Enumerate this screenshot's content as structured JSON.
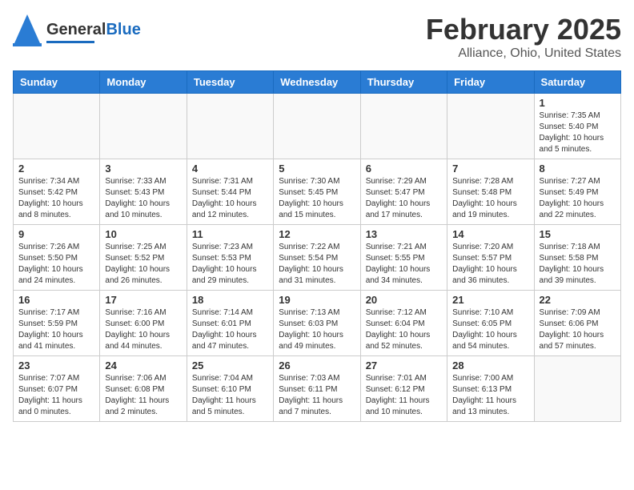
{
  "header": {
    "logo_general": "General",
    "logo_blue": "Blue",
    "title": "February 2025",
    "subtitle": "Alliance, Ohio, United States"
  },
  "days_of_week": [
    "Sunday",
    "Monday",
    "Tuesday",
    "Wednesday",
    "Thursday",
    "Friday",
    "Saturday"
  ],
  "weeks": [
    [
      {
        "day": "",
        "info": ""
      },
      {
        "day": "",
        "info": ""
      },
      {
        "day": "",
        "info": ""
      },
      {
        "day": "",
        "info": ""
      },
      {
        "day": "",
        "info": ""
      },
      {
        "day": "",
        "info": ""
      },
      {
        "day": "1",
        "info": "Sunrise: 7:35 AM\nSunset: 5:40 PM\nDaylight: 10 hours and 5 minutes."
      }
    ],
    [
      {
        "day": "2",
        "info": "Sunrise: 7:34 AM\nSunset: 5:42 PM\nDaylight: 10 hours and 8 minutes."
      },
      {
        "day": "3",
        "info": "Sunrise: 7:33 AM\nSunset: 5:43 PM\nDaylight: 10 hours and 10 minutes."
      },
      {
        "day": "4",
        "info": "Sunrise: 7:31 AM\nSunset: 5:44 PM\nDaylight: 10 hours and 12 minutes."
      },
      {
        "day": "5",
        "info": "Sunrise: 7:30 AM\nSunset: 5:45 PM\nDaylight: 10 hours and 15 minutes."
      },
      {
        "day": "6",
        "info": "Sunrise: 7:29 AM\nSunset: 5:47 PM\nDaylight: 10 hours and 17 minutes."
      },
      {
        "day": "7",
        "info": "Sunrise: 7:28 AM\nSunset: 5:48 PM\nDaylight: 10 hours and 19 minutes."
      },
      {
        "day": "8",
        "info": "Sunrise: 7:27 AM\nSunset: 5:49 PM\nDaylight: 10 hours and 22 minutes."
      }
    ],
    [
      {
        "day": "9",
        "info": "Sunrise: 7:26 AM\nSunset: 5:50 PM\nDaylight: 10 hours and 24 minutes."
      },
      {
        "day": "10",
        "info": "Sunrise: 7:25 AM\nSunset: 5:52 PM\nDaylight: 10 hours and 26 minutes."
      },
      {
        "day": "11",
        "info": "Sunrise: 7:23 AM\nSunset: 5:53 PM\nDaylight: 10 hours and 29 minutes."
      },
      {
        "day": "12",
        "info": "Sunrise: 7:22 AM\nSunset: 5:54 PM\nDaylight: 10 hours and 31 minutes."
      },
      {
        "day": "13",
        "info": "Sunrise: 7:21 AM\nSunset: 5:55 PM\nDaylight: 10 hours and 34 minutes."
      },
      {
        "day": "14",
        "info": "Sunrise: 7:20 AM\nSunset: 5:57 PM\nDaylight: 10 hours and 36 minutes."
      },
      {
        "day": "15",
        "info": "Sunrise: 7:18 AM\nSunset: 5:58 PM\nDaylight: 10 hours and 39 minutes."
      }
    ],
    [
      {
        "day": "16",
        "info": "Sunrise: 7:17 AM\nSunset: 5:59 PM\nDaylight: 10 hours and 41 minutes."
      },
      {
        "day": "17",
        "info": "Sunrise: 7:16 AM\nSunset: 6:00 PM\nDaylight: 10 hours and 44 minutes."
      },
      {
        "day": "18",
        "info": "Sunrise: 7:14 AM\nSunset: 6:01 PM\nDaylight: 10 hours and 47 minutes."
      },
      {
        "day": "19",
        "info": "Sunrise: 7:13 AM\nSunset: 6:03 PM\nDaylight: 10 hours and 49 minutes."
      },
      {
        "day": "20",
        "info": "Sunrise: 7:12 AM\nSunset: 6:04 PM\nDaylight: 10 hours and 52 minutes."
      },
      {
        "day": "21",
        "info": "Sunrise: 7:10 AM\nSunset: 6:05 PM\nDaylight: 10 hours and 54 minutes."
      },
      {
        "day": "22",
        "info": "Sunrise: 7:09 AM\nSunset: 6:06 PM\nDaylight: 10 hours and 57 minutes."
      }
    ],
    [
      {
        "day": "23",
        "info": "Sunrise: 7:07 AM\nSunset: 6:07 PM\nDaylight: 11 hours and 0 minutes."
      },
      {
        "day": "24",
        "info": "Sunrise: 7:06 AM\nSunset: 6:08 PM\nDaylight: 11 hours and 2 minutes."
      },
      {
        "day": "25",
        "info": "Sunrise: 7:04 AM\nSunset: 6:10 PM\nDaylight: 11 hours and 5 minutes."
      },
      {
        "day": "26",
        "info": "Sunrise: 7:03 AM\nSunset: 6:11 PM\nDaylight: 11 hours and 7 minutes."
      },
      {
        "day": "27",
        "info": "Sunrise: 7:01 AM\nSunset: 6:12 PM\nDaylight: 11 hours and 10 minutes."
      },
      {
        "day": "28",
        "info": "Sunrise: 7:00 AM\nSunset: 6:13 PM\nDaylight: 11 hours and 13 minutes."
      },
      {
        "day": "",
        "info": ""
      }
    ]
  ]
}
